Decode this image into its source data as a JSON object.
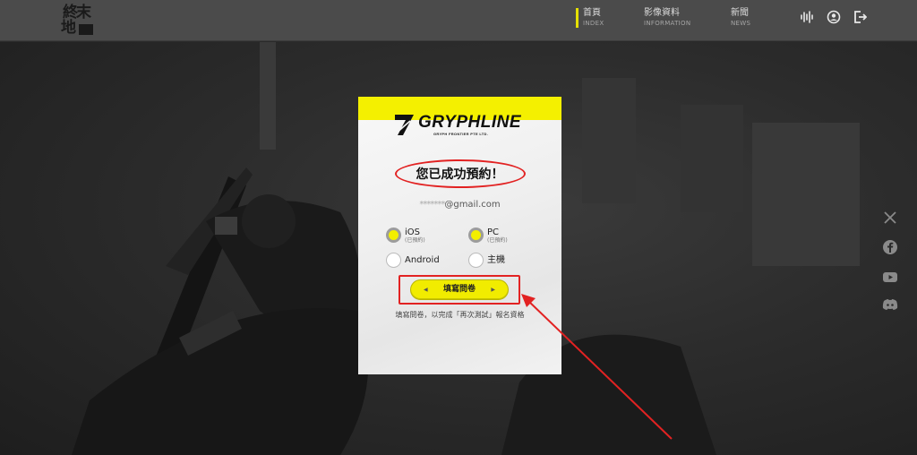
{
  "header": {
    "logo": {
      "line1": "終末",
      "line2": "地"
    },
    "nav": [
      {
        "zh": "首頁",
        "en": "INDEX",
        "active": true
      },
      {
        "zh": "影像資料",
        "en": "INFORMATION",
        "active": false
      },
      {
        "zh": "新聞",
        "en": "NEWS",
        "active": false
      }
    ],
    "icons": [
      "audio-icon",
      "account-icon",
      "logout-icon"
    ]
  },
  "social": [
    "x-icon",
    "facebook-icon",
    "youtube-icon",
    "discord-icon"
  ],
  "modal": {
    "brand": "GRYPHLINE",
    "brand_sub": "GRYPH FRONTIER PTE LTD.",
    "success_title": "您已成功預約！",
    "email_masked": "*******",
    "email_domain": "@gmail.com",
    "platforms": [
      {
        "label": "iOS",
        "sub": "(已預約)",
        "checked": true
      },
      {
        "label": "PC",
        "sub": "(已預約)",
        "checked": true
      },
      {
        "label": "Android",
        "sub": "",
        "checked": false
      },
      {
        "label": "主機",
        "sub": "",
        "checked": false
      }
    ],
    "cta_label": "填寫問卷",
    "hint": "填寫問卷，以完成「再次測試」報名資格"
  },
  "colors": {
    "accent": "#f4f000",
    "annotation": "#e22222",
    "header_bg": "#4b4b4b"
  }
}
